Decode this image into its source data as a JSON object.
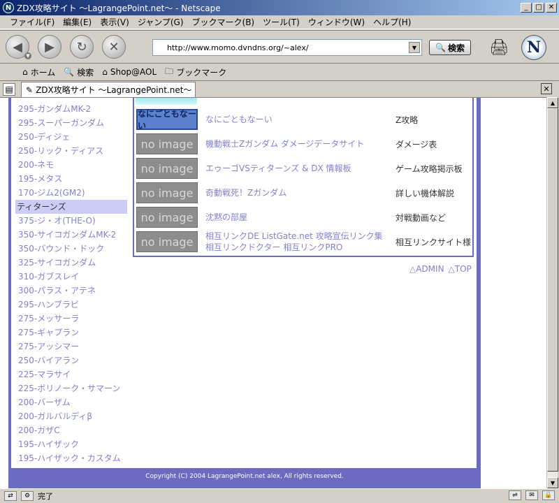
{
  "window": {
    "title": "ZDX攻略サイト 〜LagrangePoint.net〜 - Netscape",
    "app_icon": "N"
  },
  "menu": [
    "ファイル(F)",
    "編集(E)",
    "表示(V)",
    "ジャンプ(G)",
    "ブックマーク(B)",
    "ツール(T)",
    "ウィンドウ(W)",
    "ヘルプ(H)"
  ],
  "navigation": {
    "url": "http://www.momo.dvndns.org/~alex/",
    "search_label": "検索"
  },
  "personal_toolbar": {
    "home": "ホーム",
    "search": "検索",
    "shop": "Shop@AOL",
    "bookmarks": "ブックマーク"
  },
  "tab": {
    "label": "ZDX攻略サイト 〜LagrangePoint.net〜"
  },
  "sidebar": {
    "items_top": [
      "295-ガンダムMK-2",
      "295-スーパーガンダム",
      "250-ディジェ",
      "250-リック・ディアス",
      "200-ネモ",
      "195-メタス",
      "170-ジム2(GM2)"
    ],
    "section_header": "ティターンズ",
    "items_bottom": [
      "375-ジ・オ(THE-O)",
      "350-サイコガンダムMK-2",
      "350-バウンド・ドック",
      "325-サイコガンダム",
      "310-ガブスレイ",
      "300-パラス・アテネ",
      "295-ハンブラビ",
      "275-メッサーラ",
      "275-ギャプラン",
      "275-アッシマー",
      "250-バイアラン",
      "225-マラサイ",
      "225-ボリノーク・サマーン",
      "200-バーザム",
      "200-ガルバルディβ",
      "200-ガザC",
      "195-ハイザック",
      "195-ハイザック・カスタム"
    ]
  },
  "links": [
    {
      "thumb": "なにごともなーい",
      "title": "なにごともなーい",
      "title2": "",
      "desc": "Z攻略"
    },
    {
      "thumb": "no image",
      "title": "機動戦士Zガンダム ダメージデータサイト",
      "title2": "",
      "desc": "ダメージ表"
    },
    {
      "thumb": "no image",
      "title": "エゥーゴVSティターンズ & DX 情報板",
      "title2": "",
      "desc": "ゲーム攻略掲示板"
    },
    {
      "thumb": "no image",
      "title": "奇動戦死！Zガンダム",
      "title2": "",
      "desc": "詳しい機体解説"
    },
    {
      "thumb": "no image",
      "title": "沈黙の部屋",
      "title2": "",
      "desc": "対戦動画など"
    },
    {
      "thumb": "no image",
      "title": "相互リンクDE ListGate.net 攻略宣伝リンク集",
      "title2": "相互リンクドクター 相互リンクPRO",
      "desc": "相互リンクサイト様"
    }
  ],
  "admin_links": {
    "admin": "△ADMIN",
    "top": "△TOP"
  },
  "footer": {
    "copyright": "Copyright (C) 2004 LagrangePoint.net alex, All rights reserved."
  },
  "status": {
    "text": "完了"
  },
  "colors": {
    "link": "#8181d0",
    "frame": "#6b6bc0",
    "section_bg": "#cccdf6"
  }
}
